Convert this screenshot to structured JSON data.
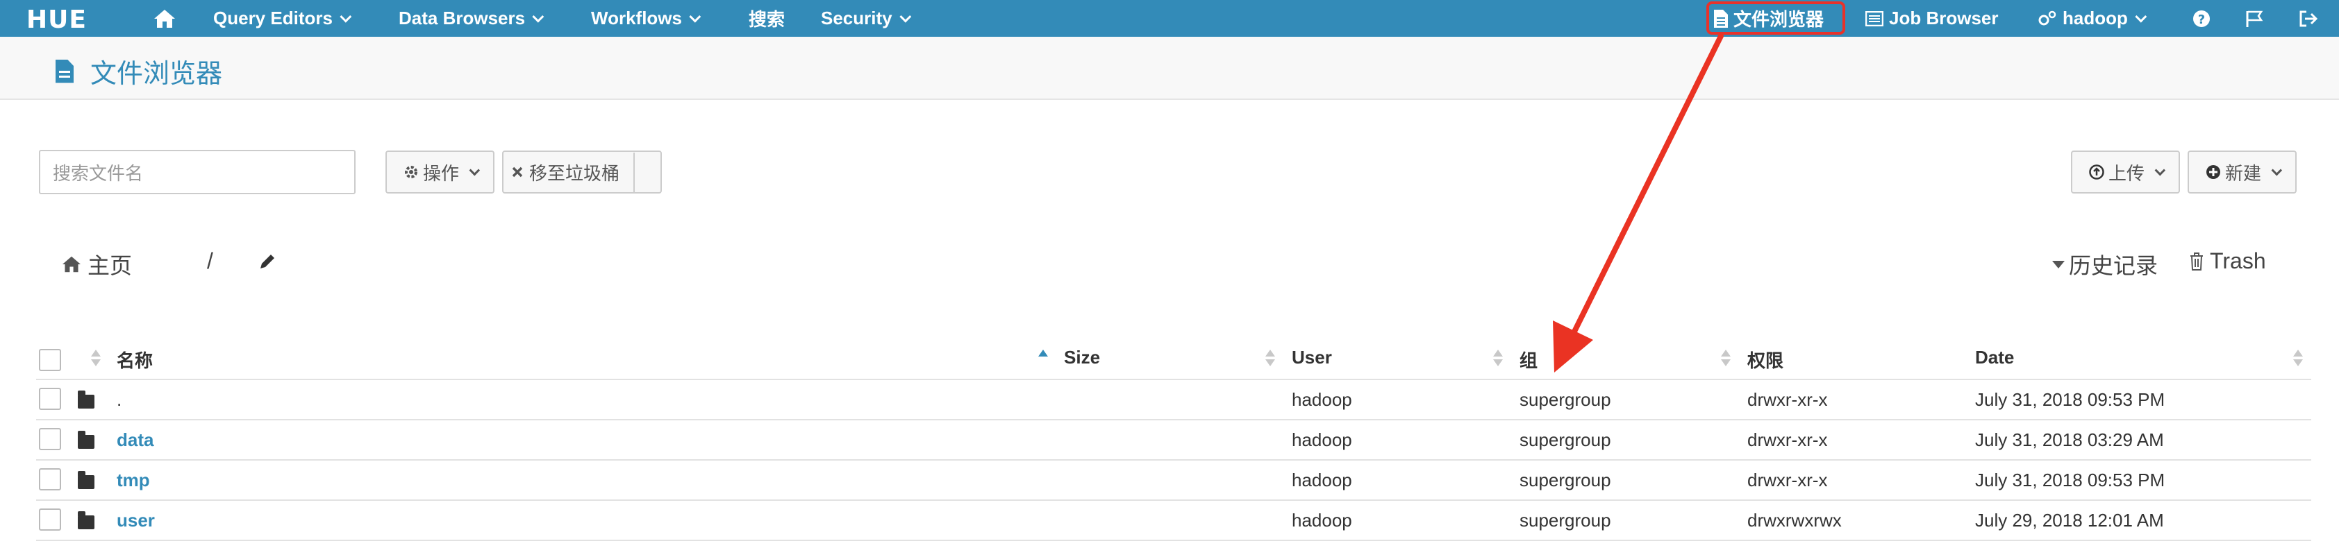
{
  "navbar": {
    "logo": "HUE",
    "items": [
      {
        "label": "Query Editors",
        "dropdown": true
      },
      {
        "label": "Data Browsers",
        "dropdown": true
      },
      {
        "label": "Workflows",
        "dropdown": true
      },
      {
        "label": "搜索",
        "dropdown": false
      },
      {
        "label": "Security",
        "dropdown": true
      }
    ],
    "right": {
      "file_browser": "文件浏览器",
      "job_browser": "Job Browser",
      "user": "hadoop"
    },
    "highlight_color": "#e8322a",
    "bg_color": "#338bb8"
  },
  "page": {
    "title": "文件浏览器"
  },
  "toolbar": {
    "search_placeholder": "搜索文件名",
    "actions_label": "操作",
    "trash_label": "移至垃圾桶",
    "upload_label": "上传",
    "new_label": "新建"
  },
  "breadcrumb": {
    "home": "主页",
    "separator": "/",
    "history": "历史记录",
    "trash": "Trash"
  },
  "table": {
    "headers": {
      "name": "名称",
      "size": "Size",
      "user": "User",
      "group": "组",
      "permissions": "权限",
      "date": "Date"
    },
    "rows": [
      {
        "name": ".",
        "size": "",
        "user": "hadoop",
        "group": "supergroup",
        "permissions": "drwxr-xr-x",
        "date": "July 31, 2018 09:53 PM",
        "link": false
      },
      {
        "name": "data",
        "size": "",
        "user": "hadoop",
        "group": "supergroup",
        "permissions": "drwxr-xr-x",
        "date": "July 31, 2018 03:29 AM",
        "link": true
      },
      {
        "name": "tmp",
        "size": "",
        "user": "hadoop",
        "group": "supergroup",
        "permissions": "drwxr-xr-x",
        "date": "July 31, 2018 09:53 PM",
        "link": true
      },
      {
        "name": "user",
        "size": "",
        "user": "hadoop",
        "group": "supergroup",
        "permissions": "drwxrwxrwx",
        "date": "July 29, 2018 12:01 AM",
        "link": true
      }
    ]
  },
  "icons": [
    "home-icon",
    "file-icon",
    "list-icon",
    "cogs-icon",
    "help-icon",
    "flag-icon",
    "logout-icon",
    "gear-icon",
    "close-icon",
    "upload-icon",
    "plus-icon",
    "pencil-icon",
    "trash-icon",
    "folder-icon"
  ]
}
